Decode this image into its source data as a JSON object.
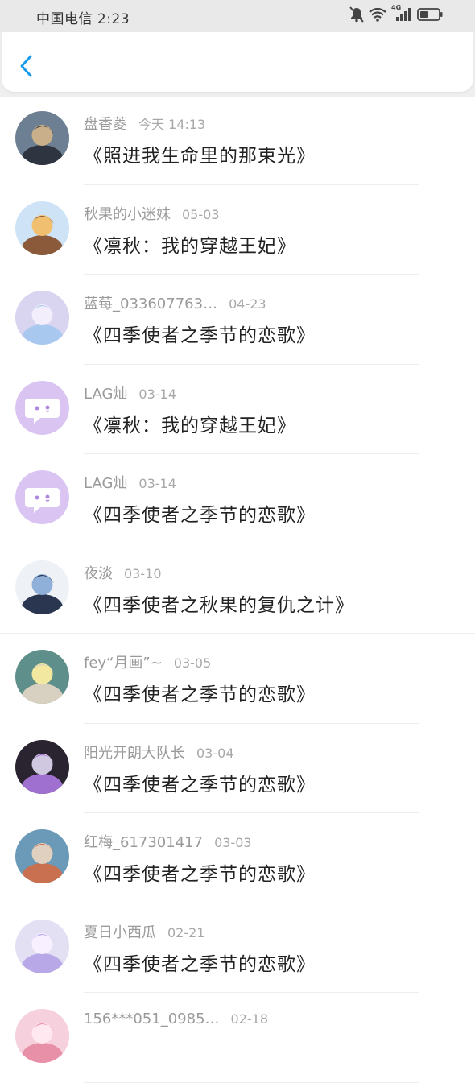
{
  "status_bar": {
    "carrier_time": "中国电信 2:23",
    "network": "4G"
  },
  "nav": {
    "back_icon": "chevron-left-icon",
    "accent_color": "#1a9ce8"
  },
  "messages": [
    {
      "user": "盘香菱",
      "time": "今天 14:13",
      "title": "《照进我生命里的那束光》",
      "avatar": "photo"
    },
    {
      "user": "秋果的小迷妹",
      "time": "05-03",
      "title": "《凛秋：我的穿越王妃》",
      "avatar": "anime"
    },
    {
      "user": "蓝莓_033607763…",
      "time": "04-23",
      "title": "《四季使者之季节的恋歌》",
      "avatar": "anime"
    },
    {
      "user": "LAG灿",
      "time": "03-14",
      "title": "《凛秋：我的穿越王妃》",
      "avatar": "default-chat"
    },
    {
      "user": "LAG灿",
      "time": "03-14",
      "title": "《四季使者之季节的恋歌》",
      "avatar": "default-chat"
    },
    {
      "user": "夜淡",
      "time": "03-10",
      "title": "《四季使者之秋果的复仇之计》",
      "avatar": "anime"
    },
    {
      "user": "fey“月画”~",
      "time": "03-05",
      "title": "《四季使者之季节的恋歌》",
      "avatar": "photo"
    },
    {
      "user": "阳光开朗大队长",
      "time": "03-04",
      "title": "《四季使者之季节的恋歌》",
      "avatar": "anime"
    },
    {
      "user": "红梅_617301417",
      "time": "03-03",
      "title": "《四季使者之季节的恋歌》",
      "avatar": "photo"
    },
    {
      "user": "夏日小西瓜",
      "time": "02-21",
      "title": "《四季使者之季节的恋歌》",
      "avatar": "anime"
    },
    {
      "user": "156***051_0985…",
      "time": "02-18",
      "title": "",
      "avatar": "anime"
    }
  ]
}
